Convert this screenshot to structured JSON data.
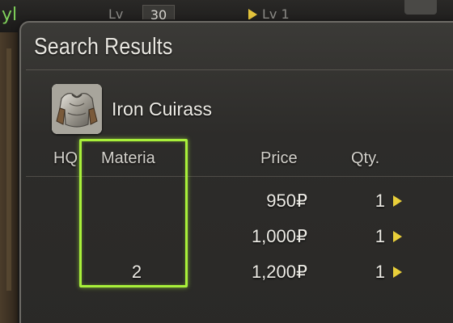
{
  "background": {
    "left_text": "yl",
    "lv_left_label": "Lv",
    "lv_value": "30",
    "lv_right_label": "Lv 1"
  },
  "window": {
    "title": "Search Results"
  },
  "item": {
    "name": "Iron Cuirass",
    "icon": "iron-cuirass-icon"
  },
  "columns": {
    "hq": "HQ",
    "materia": "Materia",
    "price": "Price",
    "qty": "Qty."
  },
  "listings": [
    {
      "materia": "",
      "price": "950₽",
      "qty": "1"
    },
    {
      "materia": "",
      "price": "1,000₽",
      "qty": "1"
    },
    {
      "materia": "2",
      "price": "1,200₽",
      "qty": "1"
    }
  ],
  "colors": {
    "highlight": "#a8f03a",
    "arrow": "#e9cf3a",
    "text": "#eeece6"
  }
}
